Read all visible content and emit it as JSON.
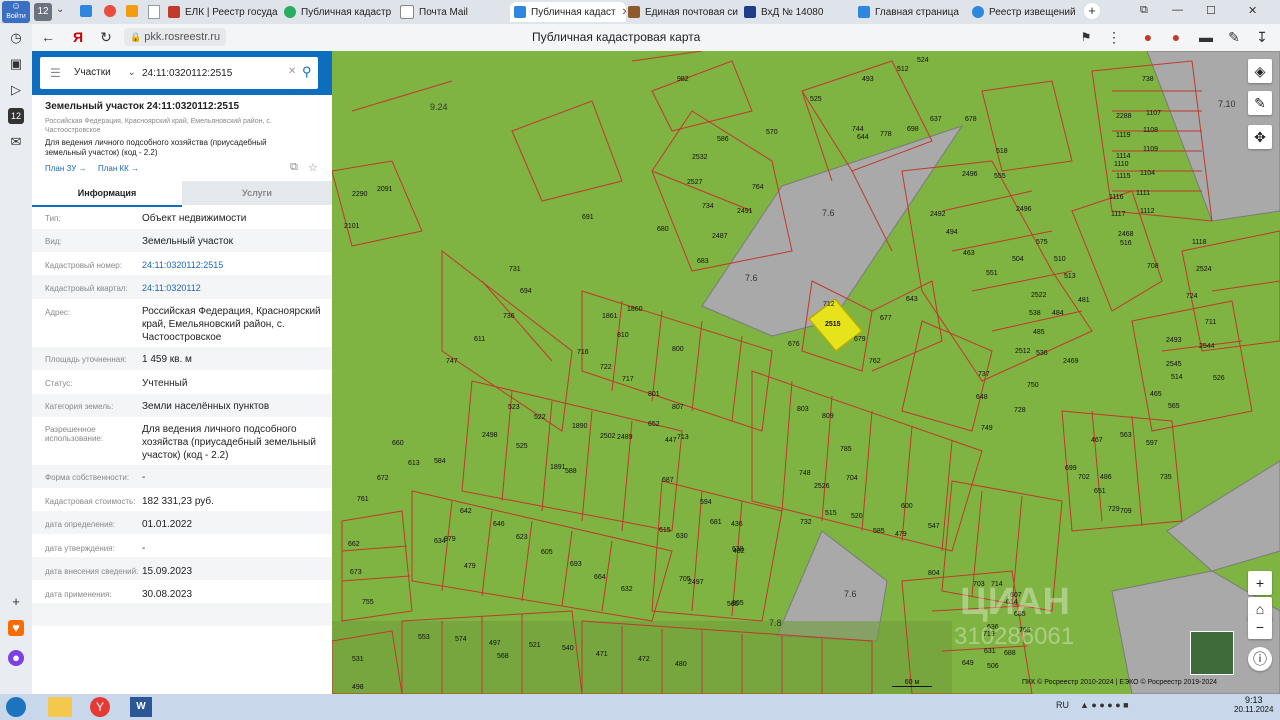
{
  "browser": {
    "tabs": [
      {
        "label": "ЕЛК | Реестр государ",
        "color": "#c0392b"
      },
      {
        "label": "Публичная кадастр",
        "color": "#27ae60"
      },
      {
        "label": "Почта Mail",
        "color": "#ffffff"
      },
      {
        "label": "Публичная кадаст",
        "color": "#2e86de"
      },
      {
        "label": "Единая почтовая си",
        "color": "#8e5a2b"
      },
      {
        "label": "ВхД № 14080",
        "color": "#1f3c88"
      },
      {
        "label": "Главная страница",
        "color": "#2e86de"
      },
      {
        "label": "Реестр извещений",
        "color": "#2e86de"
      }
    ],
    "tab_count": "12",
    "url": "pkk.rosreestr.ru",
    "page_title": "Публичная кадастровая карта",
    "login": "Войти"
  },
  "search": {
    "type_label": "Участки",
    "query": "24:11:0320112:2515"
  },
  "parcel": {
    "title": "Земельный участок 24:11:0320112:2515",
    "address_short": "Российская Федерация, Красноярский край, Емельяновский район, с. Частоостровское",
    "usage_short": "Для ведения личного подсобного хозяйства (приусадебный земельный участок) (код - 2.2)",
    "plan_zu": "План ЗУ →",
    "plan_kk": "План КК →",
    "tab_info": "Информация",
    "tab_services": "Услуги",
    "fields": [
      {
        "label": "Тип:",
        "value": "Объект недвижимости"
      },
      {
        "label": "Вид:",
        "value": "Земельный участок"
      },
      {
        "label": "Кадастровый номер:",
        "value": "24:11:0320112:2515"
      },
      {
        "label": "Кадастровый квартал:",
        "value": "24:11:0320112"
      },
      {
        "label": "Адрес:",
        "value": "Российская Федерация, Красноярский край, Емельяновский район, с. Частоостровское"
      },
      {
        "label": "Площадь уточненная:",
        "value": "1 459 кв. м"
      },
      {
        "label": "Статус:",
        "value": "Учтенный"
      },
      {
        "label": "Категория земель:",
        "value": "Земли населённых пунктов"
      },
      {
        "label": "Разрешенное использование:",
        "value": "Для ведения личного подсобного хозяйства (приусадебный земельный участок) (код - 2.2)"
      },
      {
        "label": "Форма собственности:",
        "value": "-"
      },
      {
        "label": "Кадастровая стоимость:",
        "value": "182 331,23 руб."
      },
      {
        "label": "дата определения:",
        "value": "01.01.2022"
      },
      {
        "label": "дата утверждения:",
        "value": "-"
      },
      {
        "label": "дата внесения сведений:",
        "value": "15.09.2023"
      },
      {
        "label": "дата применения:",
        "value": "30.08.2023"
      }
    ]
  },
  "map": {
    "selected_parcel": "2515",
    "zones": [
      "9.24",
      "7.10",
      "7.6",
      "7.6",
      "7.6",
      "7.8"
    ],
    "parcels": [
      "982",
      "493",
      "512",
      "524",
      "525",
      "2496",
      "644",
      "778",
      "744",
      "698",
      "637",
      "570",
      "2532",
      "586",
      "2527",
      "764",
      "734",
      "2491",
      "680",
      "2487",
      "683",
      "691",
      "2101",
      "2290",
      "2091",
      "731",
      "694",
      "736",
      "611",
      "747",
      "810",
      "1861",
      "1860",
      "800",
      "716",
      "722",
      "717",
      "801",
      "807",
      "652",
      "713",
      "712",
      "677",
      "643",
      "676",
      "679",
      "762",
      "678",
      "518",
      "555",
      "2496",
      "2492",
      "494",
      "575",
      "463",
      "504",
      "551",
      "510",
      "2522",
      "513",
      "538",
      "481",
      "484",
      "485",
      "536",
      "2469",
      "2468",
      "516",
      "708",
      "738",
      "2288",
      "1107",
      "1119",
      "1108",
      "1114",
      "1109",
      "1115",
      "1110",
      "1104",
      "1116",
      "1111",
      "1117",
      "1112",
      "1118",
      "2524",
      "724",
      "711",
      "2493",
      "2544",
      "2545",
      "514",
      "526",
      "465",
      "565",
      "2512",
      "737",
      "750",
      "648",
      "728",
      "749",
      "467",
      "563",
      "597",
      "699",
      "702",
      "486",
      "651",
      "729",
      "735",
      "709",
      "584",
      "523",
      "522",
      "1890",
      "2502",
      "2489",
      "2498",
      "525",
      "1891",
      "588",
      "447",
      "687",
      "615",
      "660",
      "672",
      "761",
      "613",
      "979",
      "642",
      "646",
      "623",
      "605",
      "693",
      "664",
      "632",
      "634",
      "479",
      "662",
      "673",
      "755",
      "803",
      "809",
      "785",
      "704",
      "748",
      "2526",
      "515",
      "520",
      "585",
      "479",
      "600",
      "547",
      "594",
      "681",
      "638",
      "436",
      "630",
      "482",
      "2497",
      "705",
      "560",
      "805",
      "732",
      "804",
      "703",
      "607",
      "636",
      "719",
      "688",
      "765",
      "614",
      "685",
      "714",
      "631",
      "649",
      "506",
      "531",
      "498",
      "553",
      "574",
      "497",
      "521",
      "540",
      "568",
      "471",
      "472",
      "480"
    ],
    "watermark": "ЦИАН",
    "watermark_id": "310286061",
    "scale": "60 м",
    "copyright": "ПКК © Росреестр 2010-2024 | ЕЭКО © Росреестр 2019-2024"
  },
  "taskbar": {
    "lang": "RU",
    "time": "9:13",
    "date": "20.11.2024"
  },
  "colors": {
    "map_green": "#7fb342",
    "parcel_border": "#c0392b",
    "zone_gray": "#a9a9a9",
    "selected": "#e6e31c",
    "accent": "#0d6dbf"
  }
}
